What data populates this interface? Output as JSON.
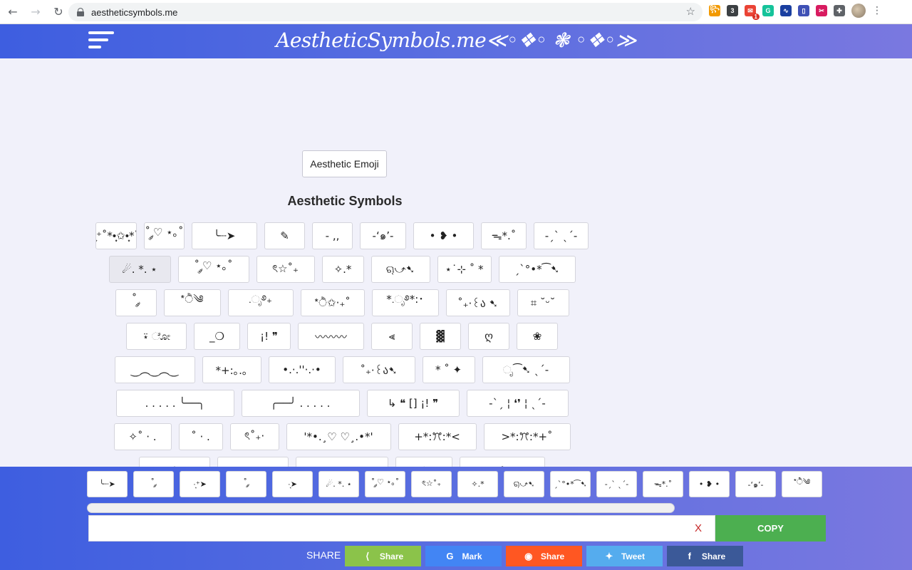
{
  "browser": {
    "url": "aestheticsymbols.me",
    "extensions": [
      {
        "name": "puzzle-ext-icon",
        "color": "#f29900",
        "text": "꧂"
      },
      {
        "name": "counter-ext-icon",
        "color": "#3c4043",
        "text": "3"
      },
      {
        "name": "mail-ext-icon",
        "color": "#ea4335",
        "text": "✉",
        "badge": "1"
      },
      {
        "name": "grammarly-ext-icon",
        "color": "#15c39a",
        "text": "G"
      },
      {
        "name": "chart-ext-icon",
        "color": "#1a3fa0",
        "text": "∿"
      },
      {
        "name": "doc-ext-icon",
        "color": "#3f51b5",
        "text": "▯"
      },
      {
        "name": "clip-ext-icon",
        "color": "#d81b60",
        "text": "✂"
      },
      {
        "name": "extensions-icon",
        "color": "#5f6368",
        "text": "✚"
      }
    ]
  },
  "header": {
    "title": "AestheticSymbols.me≪◦❖◦ ❃ ◦❖◦≫"
  },
  "main": {
    "emoji_button": "Aesthetic Emoji",
    "section_title": "Aesthetic Symbols",
    "rows": [
      [
        {
          "text": "·͙⁺˚*•̩̩͙✩•̩̩͙*˚",
          "w": 58
        },
        {
          "text": "˚ ༘♡ ⋆｡˚",
          "w": 57
        },
        {
          "text": "╰┈➤",
          "w": 92
        },
        {
          "text": "✎",
          "w": 57
        },
        {
          "text": "- ,,",
          "w": 57
        },
        {
          "text": "-‘๑’-",
          "w": 65
        },
        {
          "text": "• ❥ •",
          "w": 85
        },
        {
          "text": "ᯓ*.˚",
          "w": 64
        },
        {
          "text": "-ˏˋ ˎˊ-",
          "w": 77
        }
      ],
      [
        {
          "text": "☄. *. ⋆",
          "w": 87,
          "active": true
        },
        {
          "text": "˚ ༘♡ ⋆｡˚",
          "w": 100
        },
        {
          "text": "ৎ☆˚₊",
          "w": 82
        },
        {
          "text": "✧.*",
          "w": 59
        },
        {
          "text": "ୠ⤻➷",
          "w": 83
        },
        {
          "text": "⋆˙⊹ ˚ *",
          "w": 76
        },
        {
          "text": "ˏˋ°•*⁀➷",
          "w": 108
        }
      ],
      [
        {
          "text": "˚ ༘",
          "w": 58
        },
        {
          "text": "*ੈ༄",
          "w": 80
        },
        {
          "text": ".ೃ࿔₊",
          "w": 92
        },
        {
          "text": "*ੈ✩‧₊˚",
          "w": 90
        },
        {
          "text": "*.ೃ࿔*:･",
          "w": 94
        },
        {
          "text": "˚₊‧꒰ა ➷",
          "w": 90
        },
        {
          "text": "⌗ ˘ᵕ˘",
          "w": 73
        }
      ],
      [
        {
          "text": "⍣ ೋ",
          "w": 85
        },
        {
          "text": "_❍",
          "w": 65
        },
        {
          "text": "¡! ❞",
          "w": 61
        },
        {
          "text": "〰〰〰",
          "w": 93
        },
        {
          "text": "⪡",
          "w": 58
        },
        {
          "text": "▓",
          "w": 58
        },
        {
          "text": "ღ",
          "w": 58
        },
        {
          "text": "❀",
          "w": 58
        }
      ],
      [
        {
          "text": "‿︵‿︵‿",
          "w": 113
        },
        {
          "text": "*+:｡.｡",
          "w": 83
        },
        {
          "text": "•.·.''·.·•",
          "w": 94
        },
        {
          "text": "˚₊‧꒰ა➷",
          "w": 102
        },
        {
          "text": "* ˚ ✦",
          "w": 74
        },
        {
          "text": "ೃ⁀➷ ˎˊ-",
          "w": 123
        }
      ],
      [
        {
          "text": ". . . . . ╰──╮",
          "w": 166
        },
        {
          "text": "╭──╯ . . . . .",
          "w": 166
        },
        {
          "text": "↳ ❝ [] ¡! ❞",
          "w": 130
        },
        {
          "text": "-ˋˏ ¦ ❛❜ ¦ ˎˊ-",
          "w": 143
        }
      ],
      [
        {
          "text": "✧˚ · .",
          "w": 81
        },
        {
          "text": "˚ ·  .",
          "w": 62
        },
        {
          "text": "ৎ˚₊‧",
          "w": 69
        },
        {
          "text": "'*•.¸♡ ♡¸.•*'",
          "w": 147
        },
        {
          "text": "+*:ꔫ:*<",
          "w": 110
        },
        {
          "text": ">*:ꔫ:*+˚",
          "w": 122
        }
      ],
      [
        {
          "text": "✩",
          "w": 100
        },
        {
          "text": "⊹",
          "w": 100
        },
        {
          "text": "⋆",
          "w": 130
        },
        {
          "text": "✧",
          "w": 80
        },
        {
          "text": "❀",
          "w": 120
        }
      ]
    ]
  },
  "bottom": {
    "recent": [
      "╰┈➤",
      "˚ ༘",
      "·͙⁺➤",
      "˚ ༘",
      "·͙➤",
      "☄. *. ⋆",
      "˚ ༘♡ ⋆｡˚",
      "ৎ☆˚₊",
      "✧.*",
      "ୠ⤻➷",
      "ˏˋ°•*⁀➷",
      "-ˏˋ ˎˊ-",
      "ᯓ*.˚",
      "• ❥ •",
      "-‘๑’-",
      "*ੈ༄"
    ],
    "output_value": "",
    "clear_label": "X",
    "copy_label": "COPY",
    "share_label": "SHARE",
    "share_buttons": [
      {
        "label": "Share",
        "icon": "share-icon",
        "glyph": "⟨",
        "color": "#8bc34a"
      },
      {
        "label": "Mark",
        "icon": "google-icon",
        "glyph": "G",
        "color": "#4285f4"
      },
      {
        "label": "Share",
        "icon": "reddit-icon",
        "glyph": "◉",
        "color": "#ff5722"
      },
      {
        "label": "Tweet",
        "icon": "twitter-icon",
        "glyph": "✦",
        "color": "#55acee"
      },
      {
        "label": "Share",
        "icon": "facebook-icon",
        "glyph": "f",
        "color": "#3b5998"
      }
    ]
  }
}
